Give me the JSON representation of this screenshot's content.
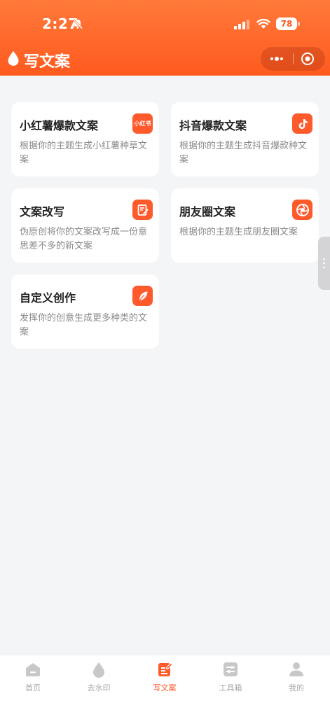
{
  "status_bar": {
    "time": "2:27",
    "battery": "78"
  },
  "nav": {
    "title": "写文案"
  },
  "cards": [
    {
      "title": "小红薯爆款文案",
      "desc": "根据你的主题生成小红薯种草文案",
      "icon": "xiaohongshu-icon",
      "icon_text": "小红书"
    },
    {
      "title": "抖音爆款文案",
      "desc": "根据你的主题生成抖音爆款种文案",
      "icon": "douyin-icon"
    },
    {
      "title": "文案改写",
      "desc": "伪原创将你的文案改写成一份意思差不多的新文案",
      "icon": "edit-document-icon"
    },
    {
      "title": "朋友圈文案",
      "desc": "根据你的主题生成朋友圈文案",
      "icon": "moments-aperture-icon"
    },
    {
      "title": "自定义创作",
      "desc": "发挥你的创意生成更多种类的文案",
      "icon": "feather-icon"
    }
  ],
  "tabbar": {
    "items": [
      {
        "label": "首页",
        "icon": "home-icon",
        "active": false
      },
      {
        "label": "去水印",
        "icon": "droplet-icon",
        "active": false
      },
      {
        "label": "写文案",
        "icon": "write-icon",
        "active": true
      },
      {
        "label": "工具箱",
        "icon": "toolbox-icon",
        "active": false
      },
      {
        "label": "我的",
        "icon": "user-icon",
        "active": false
      }
    ]
  },
  "colors": {
    "accent": "#ff5a2c",
    "header_top": "#ff7a3a",
    "background": "#f4f5f7",
    "tab_inactive": "#a9a9a9"
  }
}
